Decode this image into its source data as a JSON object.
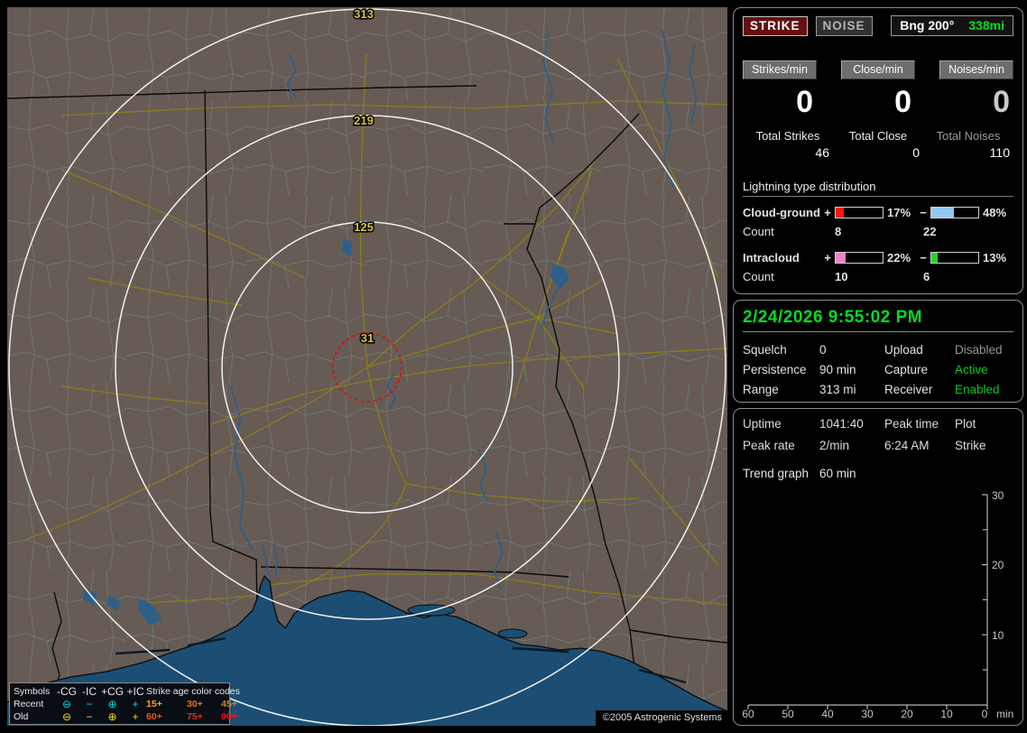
{
  "header": {
    "strike": "STRIKE",
    "noise": "NOISE",
    "bearing": "Bng 200°",
    "distance": "338mi"
  },
  "counters": {
    "columns": [
      {
        "button": "Strikes/min",
        "rate": "0",
        "total_label": "Total Strikes",
        "total": "46"
      },
      {
        "button": "Close/min",
        "rate": "0",
        "total_label": "Total Close",
        "total": "0"
      },
      {
        "button": "Noises/min",
        "rate": "0",
        "total_label": "Total Noises",
        "total": "110"
      }
    ]
  },
  "distribution": {
    "title": "Lightning type distribution",
    "rows": [
      {
        "label": "Cloud-ground",
        "plus_sign": "+",
        "minus_sign": "−",
        "plus_pct": "17%",
        "minus_pct": "48%",
        "plus_color": "#ff1414",
        "minus_color": "#92c8f0",
        "count_label": "Count",
        "plus_count": "8",
        "minus_count": "22"
      },
      {
        "label": "Intracloud",
        "plus_sign": "+",
        "minus_sign": "−",
        "plus_pct": "22%",
        "minus_pct": "13%",
        "plus_color": "#ee82c8",
        "minus_color": "#28d428",
        "count_label": "Count",
        "plus_count": "10",
        "minus_count": "6"
      }
    ]
  },
  "status": {
    "datetime": "2/24/2026 9:55:02 PM",
    "rows": [
      {
        "label1": "Squelch",
        "value1": "0",
        "label2": "Upload",
        "value2": "Disabled",
        "value2_color": "#969696"
      },
      {
        "label1": "Persistence",
        "value1": "90 min",
        "label2": "Capture",
        "value2": "Active",
        "value2_color": "#00cc22"
      },
      {
        "label1": "Range",
        "value1": "313 mi",
        "label2": "Receiver",
        "value2": "Enabled",
        "value2_color": "#00cc22"
      }
    ]
  },
  "stats": {
    "rows": [
      {
        "c1": "Uptime",
        "c2": "1041:40",
        "c3": "Peak time",
        "c4": "Plot"
      },
      {
        "c1": "Peak rate",
        "c2": "2/min",
        "c3": "6:24 AM",
        "c4": "Strike"
      }
    ],
    "trend_label": "Trend graph",
    "trend_value": "60 min"
  },
  "trend": {
    "y_ticks": [
      "30",
      "20",
      "10"
    ],
    "x_ticks": [
      "60",
      "50",
      "40",
      "30",
      "20",
      "10",
      "0"
    ],
    "x_unit": "min"
  },
  "map": {
    "ring_labels": [
      "313",
      "219",
      "125",
      "31"
    ],
    "colors": {
      "land": "#665c55",
      "water": "#1b4e72",
      "county": "#6f7d7b",
      "road": "#8d7d1a",
      "river": "#2f5e88",
      "ring": "#f0f0f0",
      "alert": "#dd1111",
      "ring_label": "#d8c342"
    },
    "legend": {
      "symbols_header": "Symbols",
      "type_headers": [
        "-CG",
        "-IC",
        "+CG",
        "+IC"
      ],
      "age_header": "Strike age color codes",
      "rows": [
        {
          "label": "Recent",
          "color": "#00e0e0",
          "symbols": [
            "⊖",
            "−",
            "⊕",
            "+"
          ],
          "ages": [
            {
              "t": "15+",
              "c": "#ffaa00"
            },
            {
              "t": "30+",
              "c": "#e87414"
            },
            {
              "t": "45+",
              "c": "#d8821e"
            }
          ]
        },
        {
          "label": "Old",
          "color": "#e6e600",
          "symbols": [
            "⊖",
            "−",
            "⊕",
            "+"
          ],
          "ages": [
            {
              "t": "60+",
              "c": "#ea5a10"
            },
            {
              "t": "75+",
              "c": "#e63214"
            },
            {
              "t": "90+",
              "c": "#f01818"
            }
          ]
        }
      ]
    },
    "copyright": "©2005 Astrogenic Systems"
  }
}
